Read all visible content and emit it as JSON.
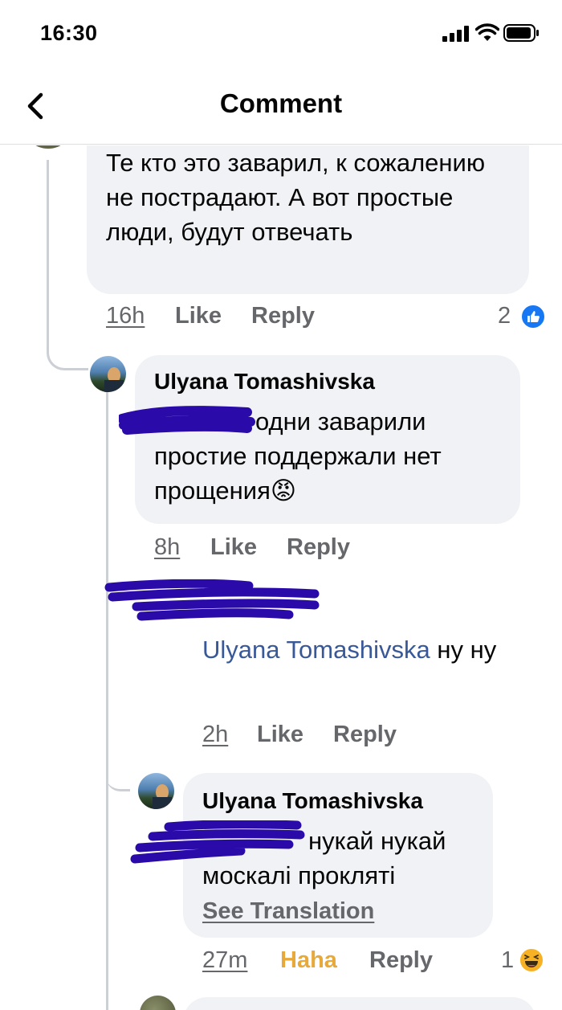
{
  "status_bar": {
    "time": "16:30"
  },
  "header": {
    "title": "Comment",
    "back_icon": "chevron-left-icon"
  },
  "comments": [
    {
      "author": "",
      "text": "Те кто это заварил, к сожалению не пострадают. А вот простые люди, будут отвечать",
      "time": "16h",
      "like": "Like",
      "reply": "Reply",
      "reaction_count": "2",
      "reaction_icon": "like-reaction-icon"
    },
    {
      "author": "Ulyana Tomashivska",
      "text": "одни заварили простие поддержали нет прощения😡",
      "time": "8h",
      "like": "Like",
      "reply": "Reply"
    },
    {
      "author": "",
      "mention": "Ulyana Tomashivska",
      "text": " ну ну",
      "time": "2h",
      "like": "Like",
      "reply": "Reply"
    },
    {
      "author": "Ulyana Tomashivska",
      "text": "нукай нукай москалі прокляті",
      "see_translation": "See Translation",
      "time": "27m",
      "like": "Haha",
      "reply": "Reply",
      "reaction_count": "1",
      "reaction_icon": "haha-reaction-icon"
    }
  ],
  "colors": {
    "bubble": "#f0f2f5",
    "mention": "#385898",
    "meta": "#65676b",
    "haha": "#e8a93b",
    "like_blue": "#1877f2",
    "redaction": "#2a0aa8"
  }
}
